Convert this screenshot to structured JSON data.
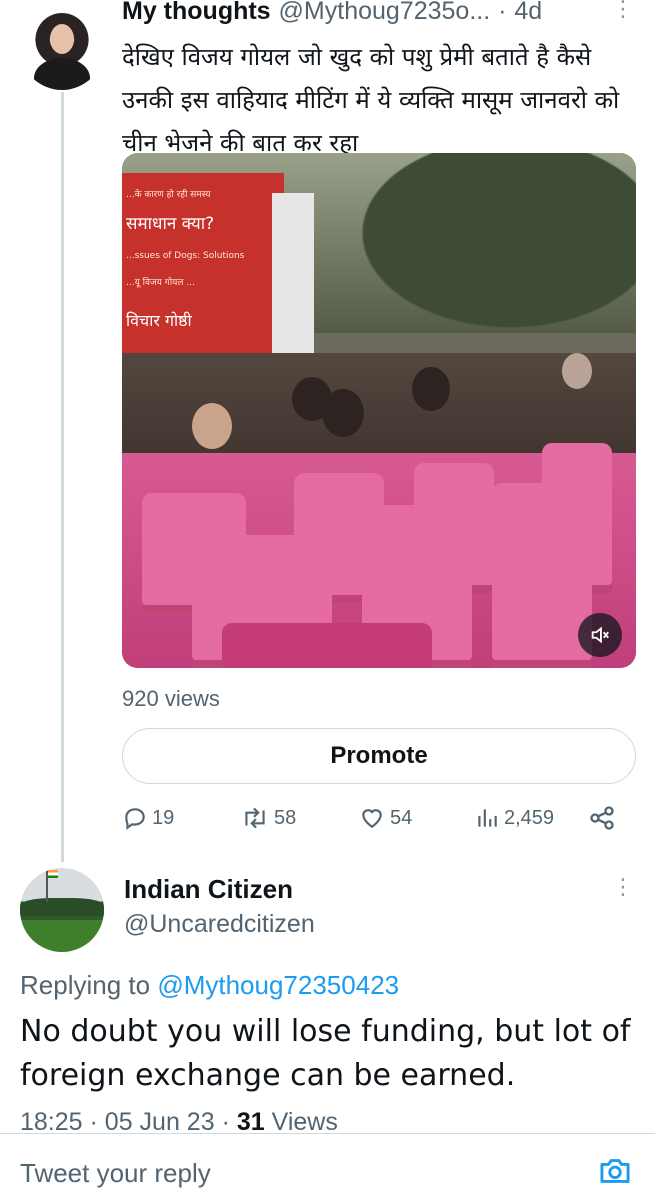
{
  "tweet1": {
    "author_name": "My thoughts",
    "handle": "@Mythoug7235o...",
    "separator": "·",
    "time": "4d",
    "text": "देखिए विजय गोयल जो खुद को पशु प्रेमी बताते है कैसे उनकी इस वाहियाद मीटिंग में ये व्यक्ति मासूम जानवरो को चीन भेजने की बात कर रहा",
    "media": {
      "banner_line1": "...के कारण हो रही समस्य",
      "banner_line2": "समाधान क्या?",
      "banner_line3": "...ssues of Dogs: Solutions",
      "banner_line4": "...यू विजय गोयल ...",
      "banner_line5": "विचार गोष्ठी",
      "mute_icon": "volume-mute-icon"
    },
    "views": "920 views",
    "promote_label": "Promote",
    "reply_count": "19",
    "retweet_count": "58",
    "like_count": "54",
    "view_count": "2,459"
  },
  "tweet2": {
    "author_name": "Indian Citizen",
    "handle": "@Uncaredcitizen",
    "replying_prefix": "Replying to",
    "replying_to": "@Mythoug72350423",
    "text": "No doubt you will lose funding, but lot of foreign exchange can be earned.",
    "time": "18:25",
    "date": "05 Jun 23",
    "views_count": "31",
    "views_label": "Views"
  },
  "reply_bar": {
    "placeholder": "Tweet your reply"
  },
  "colors": {
    "accent": "#1d9bf0",
    "text": "#0f1419",
    "secondary": "#536471",
    "border": "#cfd9de"
  }
}
